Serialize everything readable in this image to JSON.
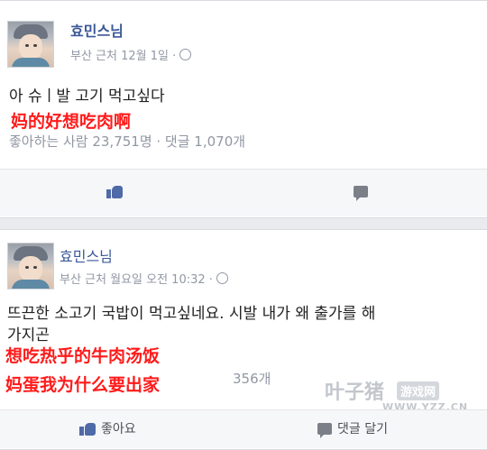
{
  "post1": {
    "author": "효민스님",
    "meta": "부산 근처 12월 1일 ·",
    "text": "아 슈ㅣ발 고기 먹고싶다",
    "caption": "妈的好想吃肉啊",
    "stats": "좋아하는 사람 23,751명 · 댓글 1,070개"
  },
  "post2": {
    "author": "효민스님",
    "meta": "부산 근처 월요일 오전 10:32 ·",
    "text_line1": "뜨끈한 소고기 국밥이 먹고싶네요. 시발 내가 왜 출가를 해",
    "text_line2": "가지곤",
    "stats_visible": "356개",
    "caption_line1": "想吃热乎的牛肉汤饭",
    "caption_line2": "妈蛋我为什么要出家",
    "like_label": "좋아요",
    "comment_label": "댓글 달기"
  },
  "watermark": {
    "brand": "叶子猪",
    "tag": "游戏网",
    "url": "WWW.YZZ.CN"
  }
}
